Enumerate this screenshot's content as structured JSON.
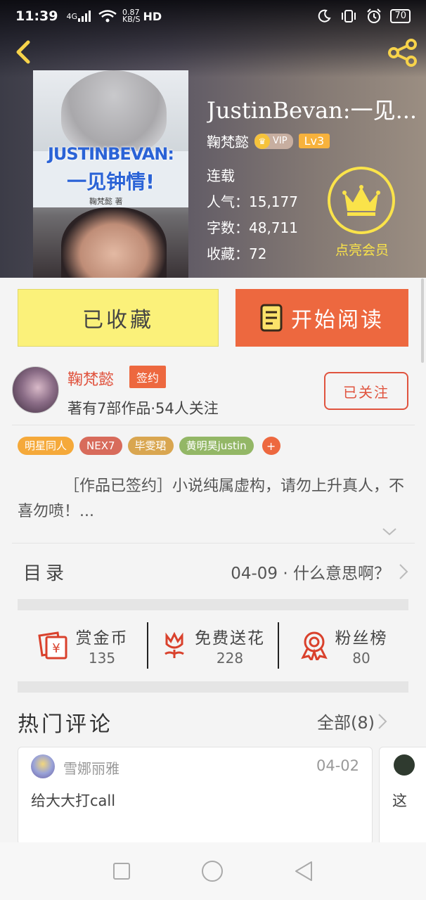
{
  "status_bar": {
    "time": "11:39",
    "network": "4G",
    "speed_value": "0.87",
    "speed_unit": "KB/S",
    "hd": "HD",
    "battery": "70"
  },
  "book": {
    "title": "JustinBevan:一见...",
    "cover_title": "JUSTINBEVAN:",
    "cover_subtitle": "一见钟情!",
    "cover_author": "鞠梵懿 著",
    "author": "鞠梵懿",
    "vip_label": "VIP",
    "level": "Lv3",
    "status": "连载",
    "popularity": "人气：15,177",
    "word_count": "字数：48,711",
    "favorites": "收藏：72",
    "member_label": "点亮会员"
  },
  "actions": {
    "collected_label": "已收藏",
    "read_label": "开始阅读"
  },
  "author_card": {
    "name": "鞠梵懿",
    "badge": "签约",
    "meta": "著有7部作品·54人关注",
    "follow_label": "已关注"
  },
  "tags": [
    {
      "label": "明星同人",
      "color": "#f5a93a"
    },
    {
      "label": "NEX7",
      "color": "#d86b5b"
    },
    {
      "label": "毕雯珺",
      "color": "#d9a650"
    },
    {
      "label": "黄明昊justin",
      "color": "#93b766"
    }
  ],
  "tag_add": "+",
  "description": "［作品已签约］小说纯属虚构，请勿上升真人，不喜勿喷！...",
  "catalog": {
    "label": "目录",
    "latest": "04-09 · 什么意思啊？"
  },
  "rewards": [
    {
      "title": "赏金币",
      "value": "135",
      "icon": "red-envelope-icon"
    },
    {
      "title": "免费送花",
      "value": "228",
      "icon": "flower-icon"
    },
    {
      "title": "粉丝榜",
      "value": "80",
      "icon": "medal-icon"
    }
  ],
  "comments_section": {
    "title": "热门评论",
    "all_label": "全部(8)"
  },
  "comments": [
    {
      "user": "雪娜丽雅",
      "date": "04-02",
      "text": "给大大打call"
    },
    {
      "text": "这"
    }
  ],
  "colors": {
    "accent": "#ed683f",
    "yellow": "#fbf17a",
    "gold": "#fae34a"
  }
}
